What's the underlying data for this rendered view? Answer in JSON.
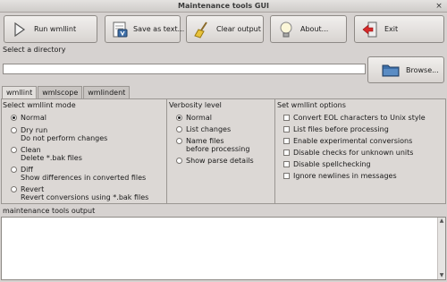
{
  "window": {
    "title": "Maintenance tools GUI",
    "close_glyph": "×"
  },
  "toolbar": {
    "run_label": "Run wmllint",
    "save_label": "Save as text...",
    "clear_label": "Clear output",
    "about_label": "About...",
    "exit_label": "Exit"
  },
  "directory": {
    "label": "Select a directory",
    "value": "",
    "browse_label": "Browse..."
  },
  "tabs": [
    {
      "label": "wmllint",
      "active": true
    },
    {
      "label": "wmlscope",
      "active": false
    },
    {
      "label": "wmlindent",
      "active": false
    }
  ],
  "mode": {
    "title": "Select wmllint mode",
    "options": [
      {
        "line1": "Normal",
        "line2": "",
        "selected": true
      },
      {
        "line1": "Dry run",
        "line2": "Do not perform changes",
        "selected": false
      },
      {
        "line1": "Clean",
        "line2": "Delete *.bak files",
        "selected": false
      },
      {
        "line1": "Diff",
        "line2": "Show differences in converted files",
        "selected": false
      },
      {
        "line1": "Revert",
        "line2": "Revert conversions using *.bak files",
        "selected": false
      }
    ]
  },
  "verbosity": {
    "title": "Verbosity level",
    "options": [
      {
        "line1": "Normal",
        "line2": "",
        "selected": true
      },
      {
        "line1": "List changes",
        "line2": "",
        "selected": false
      },
      {
        "line1": "Name files",
        "line2": "before processing",
        "selected": false
      },
      {
        "line1": "Show parse details",
        "line2": "",
        "selected": false
      }
    ]
  },
  "wmllint_options": {
    "title": "Set wmllint options",
    "options": [
      {
        "label": "Convert EOL characters to Unix style",
        "checked": false
      },
      {
        "label": "List files before processing",
        "checked": false
      },
      {
        "label": "Enable experimental conversions",
        "checked": false
      },
      {
        "label": "Disable checks for unknown units",
        "checked": false
      },
      {
        "label": "Disable spellchecking",
        "checked": false
      },
      {
        "label": "Ignore newlines in messages",
        "checked": false
      }
    ]
  },
  "output": {
    "label": "maintenance tools output",
    "text": ""
  },
  "colors": {
    "exit_arrow": "#d62a2a",
    "folder_blue": "#3d6fa8"
  }
}
